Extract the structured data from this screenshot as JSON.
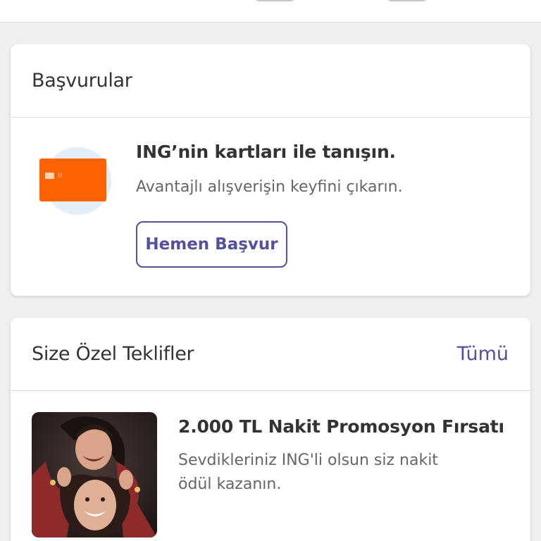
{
  "applications": {
    "title": "Başvurular",
    "promo_title": "ING’nin kartları ile tanışın.",
    "promo_subtitle": "Avantajlı alışverişin keyfini çıkarın.",
    "apply_button": "Hemen Başvur"
  },
  "offers": {
    "title": "Size Özel Teklifler",
    "see_all": "Tümü",
    "items": [
      {
        "title": "2.000 TL Nakit Promosyon Fırsatı",
        "description": "Sevdikleriniz ING'li olsun siz nakit ödül kazanın."
      }
    ]
  },
  "colors": {
    "brand_orange": "#ff6200",
    "accent_purple": "#525199",
    "background": "#efefef"
  }
}
